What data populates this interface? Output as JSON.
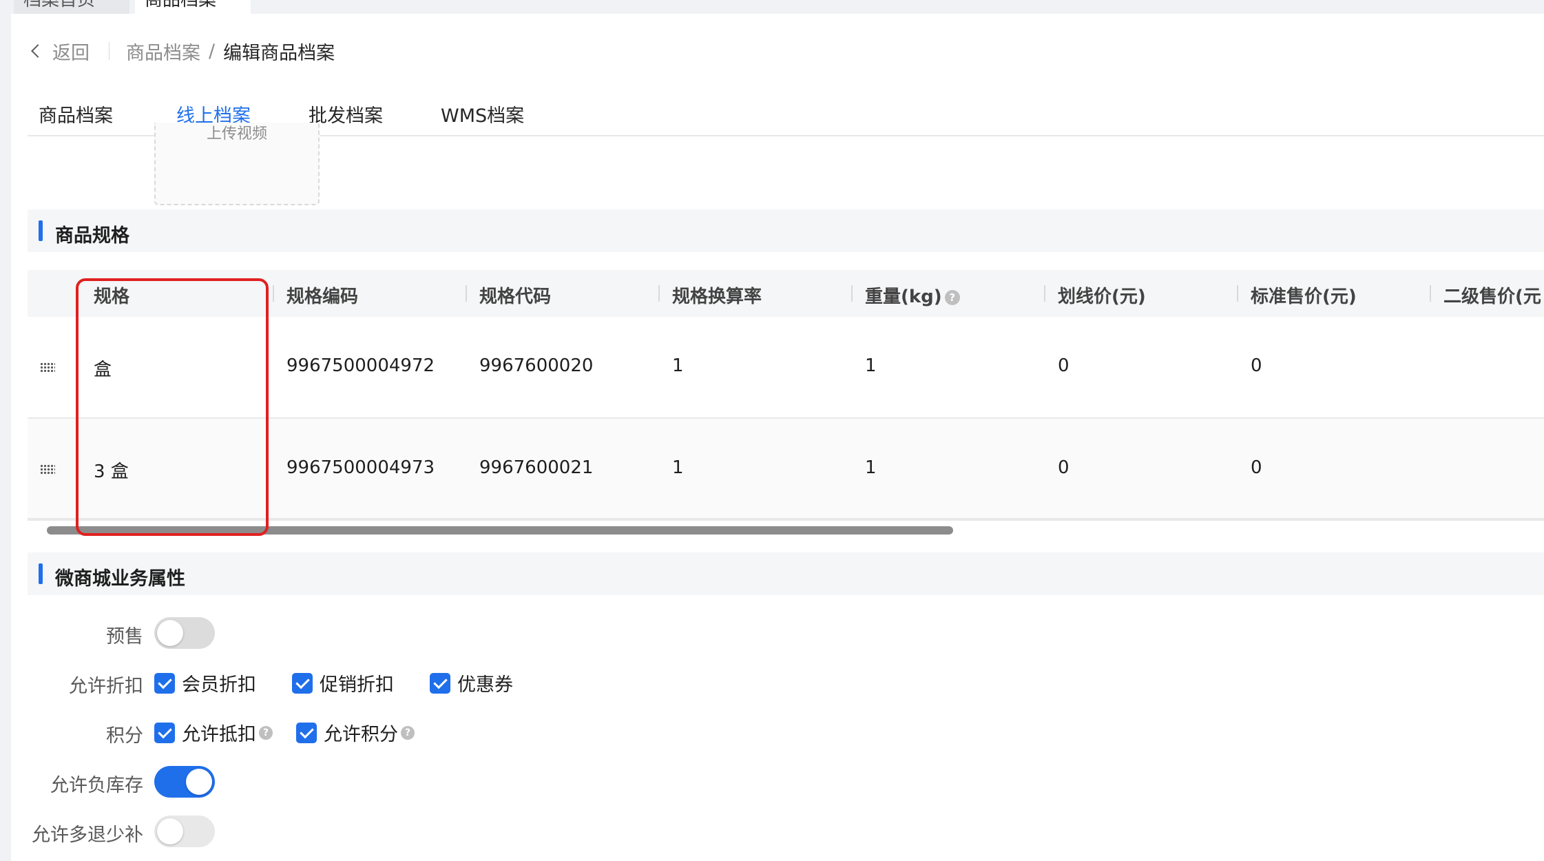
{
  "page_tabs": [
    "档案首页",
    "商品档案"
  ],
  "breadcrumb": {
    "back": "返回",
    "parent": "商品档案",
    "separator": "/",
    "current": "编辑商品档案"
  },
  "tabs": [
    {
      "label": "商品档案",
      "active": false
    },
    {
      "label": "线上档案",
      "active": true
    },
    {
      "label": "批发档案",
      "active": false
    },
    {
      "label": "WMS档案",
      "active": false
    }
  ],
  "upload": {
    "label": "上传视频"
  },
  "spec_section": {
    "title": "商品规格",
    "columns": [
      "规格",
      "规格编码",
      "规格代码",
      "规格换算率",
      "重量(kg)",
      "划线价(元)",
      "标准售价(元)",
      "二级售价(元"
    ],
    "rows": [
      [
        "盒",
        "9967500004972",
        "9967600020",
        "1",
        "1",
        "0",
        "0"
      ],
      [
        "3 盒",
        "9967500004973",
        "9967600021",
        "1",
        "1",
        "0",
        "0"
      ]
    ]
  },
  "mall_section": {
    "title": "微商城业务属性",
    "presale": {
      "label": "预售",
      "on": false
    },
    "discount": {
      "label": "允许折扣",
      "options": [
        "会员折扣",
        "促销折扣",
        "优惠券"
      ]
    },
    "points": {
      "label": "积分",
      "options": [
        "允许抵扣",
        "允许积分"
      ]
    },
    "negative_stock": {
      "label": "允许负库存",
      "on": true
    },
    "over_return": {
      "label": "允许多退少补",
      "on": false
    }
  },
  "colors": {
    "accent": "#1f6feb",
    "highlight": "#e02020"
  }
}
